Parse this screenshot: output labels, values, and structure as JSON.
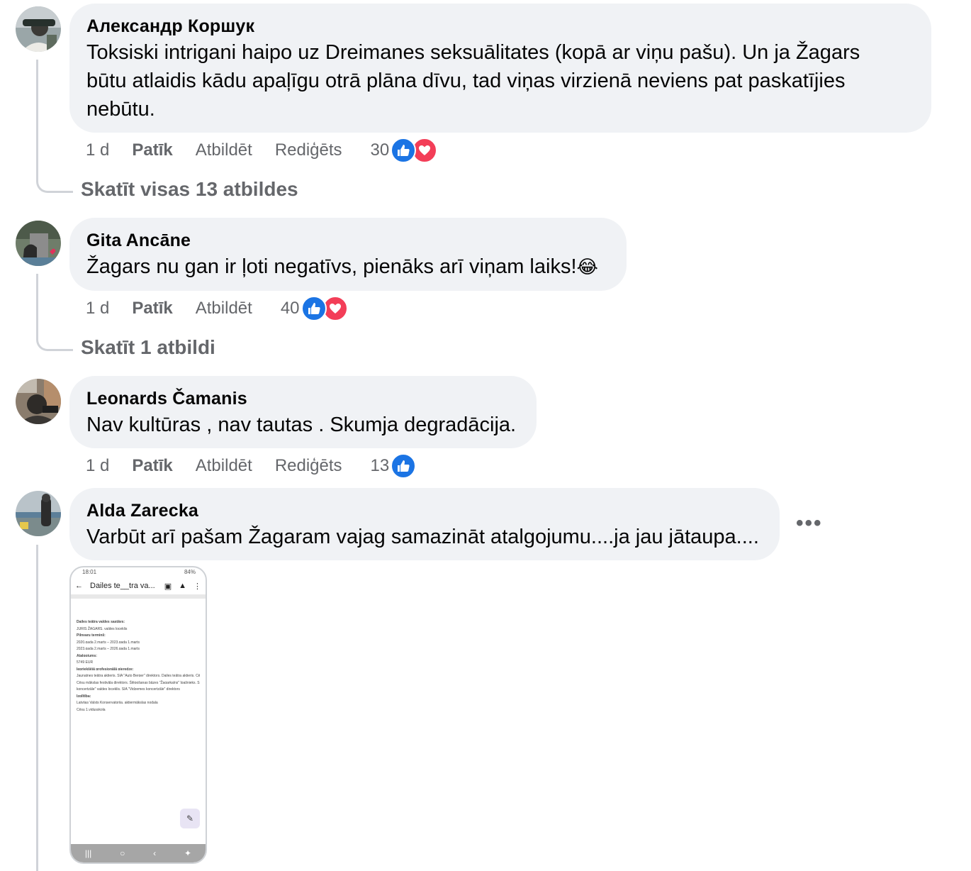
{
  "comments": [
    {
      "author": "Александр Коршук",
      "text": "Toksiski intrigani haipo uz Dreimanes seksuālitates (kopā ar viņu pašu). Un ja Žagars būtu atlaidis kādu apaļīgu otrā plāna dīvu, tad viņas virzienā neviens pat paskatījies nebūtu.",
      "time": "1 d",
      "like_label": "Patīk",
      "reply_label": "Atbildēt",
      "edited_label": "Rediģēts",
      "reaction_count": "30",
      "reactions": [
        "like-icon",
        "love-icon"
      ],
      "view_replies": "Skatīt visas 13 atbildes"
    },
    {
      "author": "Gita Ancāne",
      "text": "Žagars nu gan ir ļoti negatīvs, pienāks arī viņam laiks!",
      "emoji": "😂",
      "time": "1 d",
      "like_label": "Patīk",
      "reply_label": "Atbildēt",
      "reaction_count": "40",
      "reactions": [
        "like-icon",
        "love-icon"
      ],
      "view_replies": "Skatīt 1 atbildi"
    },
    {
      "author": "Leonards Čamanis",
      "text": "Nav kultūras , nav tautas . Skumja degradācija.",
      "time": "1 d",
      "like_label": "Patīk",
      "reply_label": "Atbildēt",
      "edited_label": "Rediģēts",
      "reaction_count": "13",
      "reactions": [
        "like-icon"
      ]
    },
    {
      "author": "Alda Zarecka",
      "text": "Varbūt arī pašam Žagaram vajag samazināt atalgojumu....ja jau jātaupa....",
      "more_label": "•••",
      "attachment": {
        "status_time": "18:01",
        "status_battery": "84%",
        "doc_title": "Dailes te__tra va...",
        "doc_lines": [
          "Dailes teātra valdes sastāvs:",
          "JURIS ŽAGARS, valdes loceklis",
          "Pilnvaru termiņš:",
          "2020.gada 2.marts – 2023.gada 1.marts",
          "2023.gada 2.marts – 2026.gada 1.marts",
          "Atalgojums:",
          "5749 EUR",
          "Iepriekšējā profesionālā pieredze:",
          "Jaunatnes teātra aktieris, SIA \"Auto Berger\" direktors, Dailes teātra aktieris, Cēsu drāmas dejotājs,",
          "Cēsu mākslas festivāla direktors, Ślēpošanas bāzes \"Žagarkalns\" īpašnieks, SIA \"Vidzemes",
          "koncertzāle\" valdes loceklis, SIA \"Vidzemes koncertzāle\" direktors",
          "Izglītība:",
          "Latvijas Valsts Konservatorija, aktiermākslas nodaļa",
          "Cēsu 1.vidusskola"
        ]
      }
    }
  ],
  "colors": {
    "bubble": "#f0f2f5",
    "secondary_text": "#65676b",
    "like_blue": "#1b74e4",
    "love_red": "#f33e58",
    "thread_line": "#d0d3d8"
  }
}
